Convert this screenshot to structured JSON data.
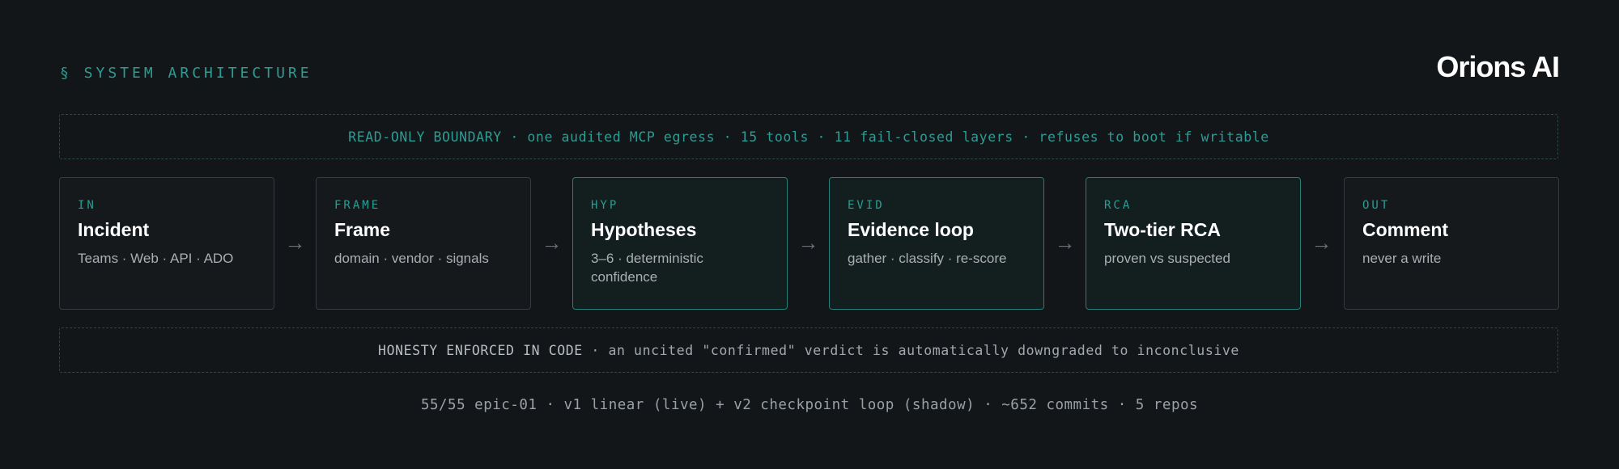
{
  "header": {
    "section_label": "§ SYSTEM ARCHITECTURE",
    "brand": "Orions AI"
  },
  "banner_top": {
    "text": "READ-ONLY BOUNDARY · one audited MCP egress · 15 tools · 11 fail-closed layers · refuses to boot if writable"
  },
  "flow": {
    "stages": [
      {
        "tag": "IN",
        "title": "Incident",
        "subtitle": "Teams · Web · API · ADO",
        "highlighted": false
      },
      {
        "tag": "FRAME",
        "title": "Frame",
        "subtitle": "domain · vendor · signals",
        "highlighted": false
      },
      {
        "tag": "HYP",
        "title": "Hypotheses",
        "subtitle": "3–6 · deterministic confidence",
        "highlighted": true
      },
      {
        "tag": "EVID",
        "title": "Evidence loop",
        "subtitle": "gather · classify · re-score",
        "highlighted": true
      },
      {
        "tag": "RCA",
        "title": "Two-tier RCA",
        "subtitle": "proven vs suspected",
        "highlighted": true
      },
      {
        "tag": "OUT",
        "title": "Comment",
        "subtitle": "never a write",
        "highlighted": false
      }
    ],
    "connector_glyph": "→"
  },
  "banner_bottom": {
    "lead": "HONESTY ENFORCED IN CODE",
    "text": " · an uncited \"confirmed\" verdict is automatically downgraded to inconclusive"
  },
  "footer": {
    "text": "55/55 epic-01 · v1 linear (live) + v2 checkpoint loop (shadow) · ~652 commits · 5 repos"
  },
  "colors": {
    "background": "#131619",
    "accent": "#2a9d94",
    "accent_border": "#237f77"
  }
}
